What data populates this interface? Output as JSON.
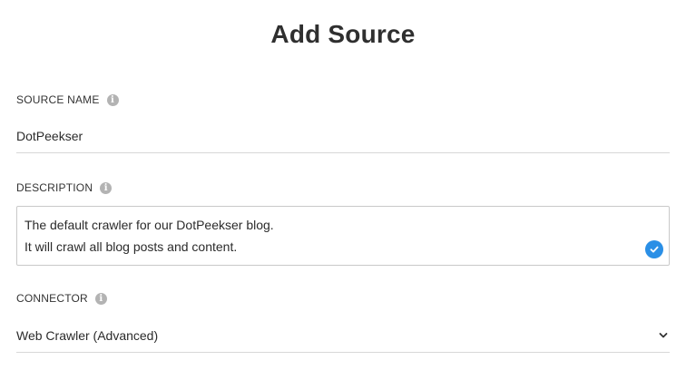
{
  "page": {
    "title": "Add Source"
  },
  "source_name": {
    "label": "SOURCE NAME",
    "value": "DotPeekser",
    "info_icon": "info-icon"
  },
  "description": {
    "label": "DESCRIPTION",
    "lines": [
      "The default crawler for our DotPeekser blog.",
      "It will crawl all blog posts and content."
    ],
    "status_icon": "check-circle-icon",
    "info_icon": "info-icon"
  },
  "connector": {
    "label": "CONNECTOR",
    "selected": "Web Crawler (Advanced)",
    "dropdown_icon": "chevron-down-icon",
    "info_icon": "info-icon"
  },
  "colors": {
    "accent": "#2a8fe6",
    "info_icon": "#b3b3b3",
    "divider": "#d8d8d8"
  }
}
